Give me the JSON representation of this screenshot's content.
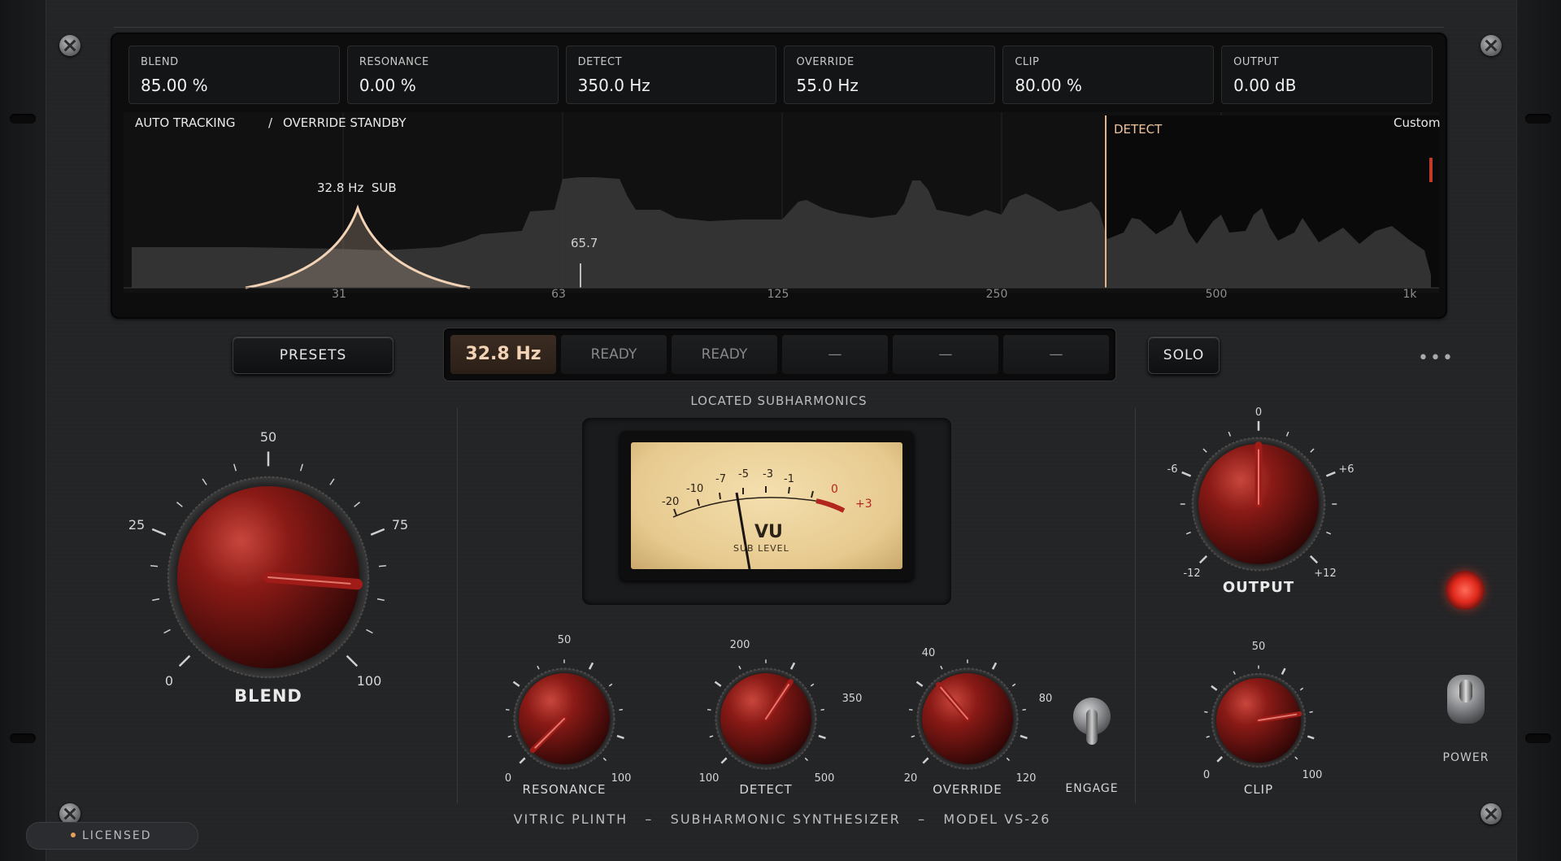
{
  "readouts": [
    {
      "label": "BLEND",
      "value": "85.00 %"
    },
    {
      "label": "RESONANCE",
      "value": "0.00 %"
    },
    {
      "label": "DETECT",
      "value": "350.0 Hz"
    },
    {
      "label": "OVERRIDE",
      "value": "55.0 Hz"
    },
    {
      "label": "CLIP",
      "value": "80.00 %"
    },
    {
      "label": "OUTPUT",
      "value": "0.00 dB"
    }
  ],
  "analyzer": {
    "mode_left": "AUTO TRACKING",
    "separator": "/",
    "mode_right": "OVERRIDE STANDBY",
    "peak_label": "32.8 Hz  SUB",
    "marker_label": "65.7",
    "detect_label": "DETECT",
    "preset_label": "Custom",
    "freq_ticks": [
      "31",
      "63",
      "125",
      "250",
      "500",
      "1k"
    ]
  },
  "toolbar": {
    "presets_label": "PRESETS",
    "solo_label": "SOLO",
    "more_label": "•••",
    "slots": [
      "32.8 Hz",
      "READY",
      "READY",
      "—",
      "—",
      "—"
    ]
  },
  "center_title": "LOCATED SUBHARMONICS",
  "vu": {
    "scale": [
      "-20",
      "-10",
      "-7",
      "-5",
      "-3",
      "-1",
      "0",
      "+3"
    ],
    "title": "VU",
    "subtitle": "SUB LEVEL"
  },
  "knobs": {
    "blend": {
      "label": "BLEND",
      "scale": [
        "0",
        "25",
        "50",
        "75",
        "100"
      ],
      "value_pct": 85
    },
    "output": {
      "label": "OUTPUT",
      "scale": [
        "-12",
        "-6",
        "0",
        "+6",
        "+12"
      ],
      "value_db": 0
    },
    "resonance": {
      "label": "RESONANCE",
      "scale": [
        "0",
        "50",
        "100"
      ],
      "value_pct": 0
    },
    "detect": {
      "label": "DETECT",
      "scale": [
        "100",
        "200",
        "350",
        "500"
      ],
      "value_hz": 350
    },
    "override": {
      "label": "OVERRIDE",
      "scale": [
        "20",
        "40",
        "80",
        "120"
      ],
      "value_hz": 55
    },
    "clip": {
      "label": "CLIP",
      "scale": [
        "0",
        "50",
        "100"
      ],
      "value_pct": 80
    }
  },
  "engage_label": "ENGAGE",
  "power_label": "POWER",
  "footer": "VITRIC PLINTH   –   SUBHARMONIC SYNTHESIZER   –   MODEL VS-26",
  "licensed_label": "LICENSED",
  "colors": {
    "accent": "#f3d3b5",
    "knob_red": "#8a1a16",
    "vu_face": "#e6c98e",
    "led_red": "#e0291c"
  }
}
